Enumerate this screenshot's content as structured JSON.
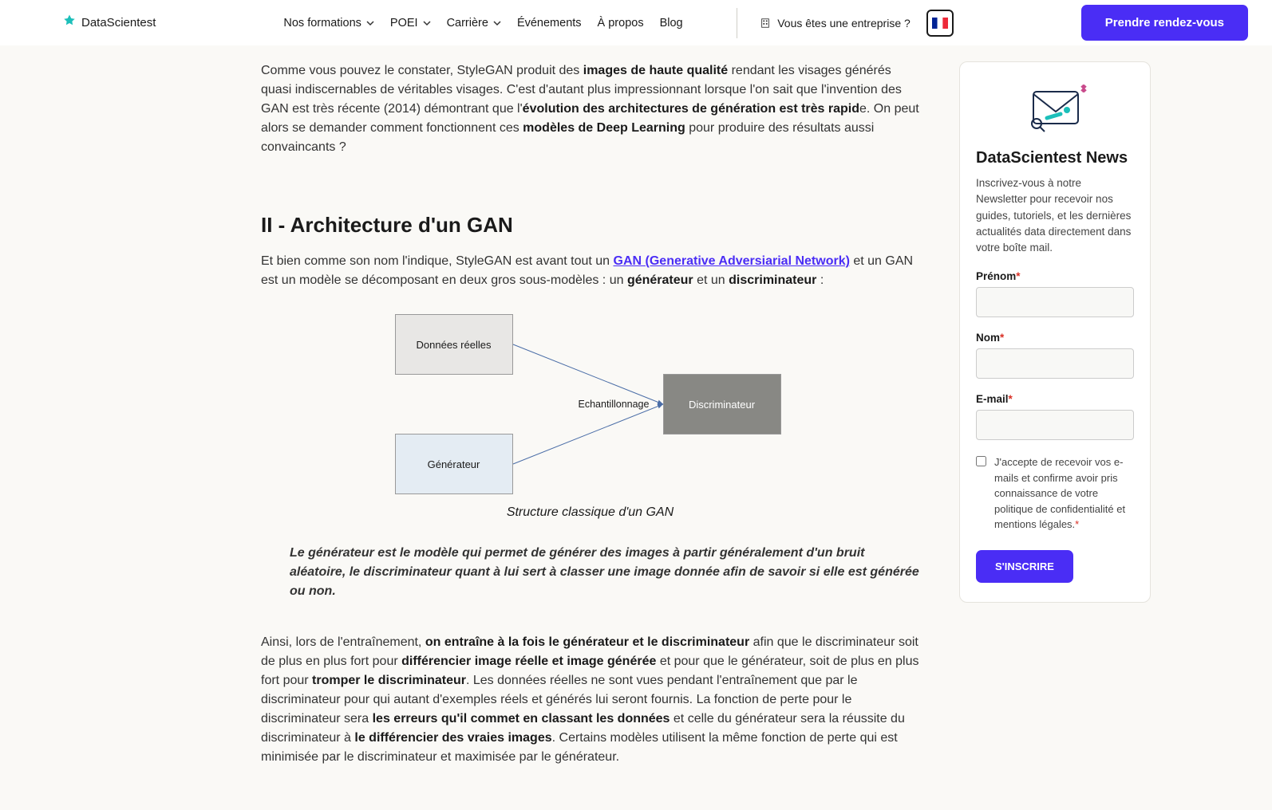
{
  "header": {
    "logo_text": "DataScientest",
    "nav": {
      "formations": "Nos formations",
      "poei": "POEI",
      "carriere": "Carrière",
      "evenements": "Événements",
      "apropos": "À propos",
      "blog": "Blog"
    },
    "enterprise_text": "Vous êtes une entreprise ?",
    "cta_label": "Prendre rendez-vous"
  },
  "article": {
    "para1_a": "Comme vous pouvez le constater, StyleGAN produit des ",
    "para1_b": "images de haute qualité",
    "para1_c": " rendant les visages générés quasi indiscernables de véritables visages. C'est d'autant plus impressionnant lorsque l'on sait que l'invention des GAN est très récente (2014) démontrant que l'",
    "para1_d": "évolution des architectures de génération est très rapid",
    "para1_e": "e. On peut alors se demander comment fonctionnent ces ",
    "para1_f": "modèles de Deep Learning",
    "para1_g": " pour produire des résultats aussi convaincants ?",
    "heading2": "II - Architecture d'un GAN",
    "para2_a": "Et bien comme son nom l'indique, StyleGAN est avant tout un ",
    "para2_link": "GAN (Generative Adversiarial Network)",
    "para2_b": " et un GAN est un modèle se décomposant en deux gros sous-modèles : un ",
    "para2_c": "générateur",
    "para2_d": " et un ",
    "para2_e": "discriminateur",
    "para2_f": " :",
    "diagram": {
      "box1": "Données réelles",
      "box2": "Générateur",
      "box3": "Discriminateur",
      "label": "Echantillonnage"
    },
    "caption": "Structure classique d'un GAN",
    "quote": "Le générateur est le modèle qui permet de générer des images à partir généralement d'un bruit aléatoire, le discriminateur quant à lui sert à classer une image donnée afin de savoir si elle est générée ou non.",
    "para3_a": "Ainsi, lors de l'entraînement, ",
    "para3_b": "on entraîne à la fois le générateur et le discriminateur",
    "para3_c": " afin que le discriminateur soit de plus en plus fort pour ",
    "para3_d": "différencier image réelle et image générée",
    "para3_e": " et pour que le générateur, soit de plus en plus fort pour ",
    "para3_f": "tromper le discriminateur",
    "para3_g": ". Les données réelles ne sont vues pendant l'entraînement que par le discriminateur pour qui autant d'exemples réels et générés lui seront fournis. La fonction de perte pour le discriminateur sera ",
    "para3_h": "les erreurs qu'il commet en classant les données",
    "para3_i": " et celle du générateur sera la réussite du discriminateur à ",
    "para3_j": "le différencier des vraies images",
    "para3_k": ". Certains modèles utilisent la même fonction de perte qui est minimisée par le discriminateur et maximisée par le générateur."
  },
  "sidebar": {
    "title": "DataScientest News",
    "desc": "Inscrivez-vous à notre Newsletter pour recevoir nos guides, tutoriels, et les dernières actualités data directement dans votre boîte mail.",
    "prenom": "Prénom",
    "nom": "Nom",
    "email": "E-mail",
    "consent": "J'accepte de recevoir vos e-mails et confirme avoir pris connaissance de votre politique de confidentialité et mentions légales.",
    "submit": "S'INSCRIRE"
  }
}
